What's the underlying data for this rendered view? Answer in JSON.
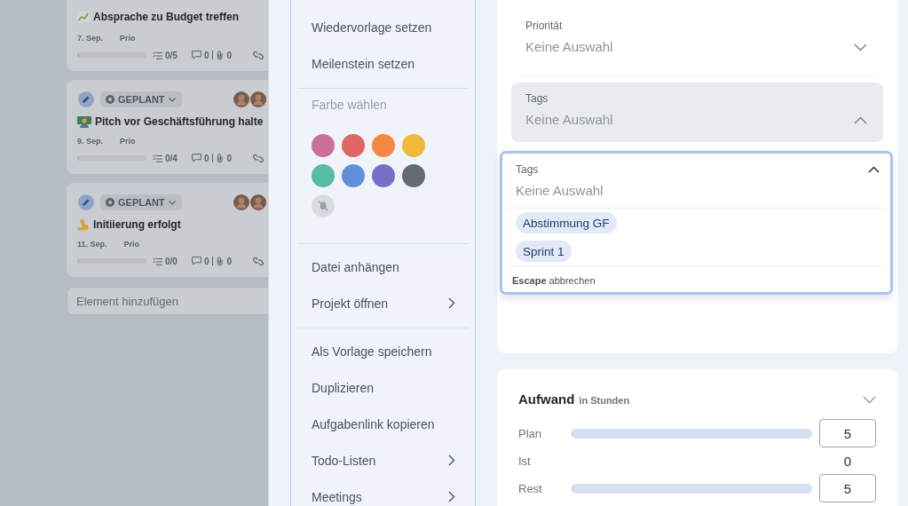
{
  "board": {
    "cards": [
      {
        "title": "Absprache zu Budget treffen",
        "date": "7. Sep.",
        "priority": "Prio",
        "level": 0,
        "checklist": "0/5",
        "comments": "0",
        "attachments": "0"
      },
      {
        "status": "GEPLANT",
        "assignees": [
          {
            "kind": "photo"
          },
          {
            "kind": "photo"
          }
        ],
        "title": "Pitch vor Geschäftsführung halte",
        "date": "9. Sep.",
        "priority": "Prio",
        "level": 0,
        "checklist": "0/4",
        "comments": "0",
        "attachments": "0"
      },
      {
        "status": "GEPLANT",
        "assignees": [
          {
            "kind": "photo"
          },
          {
            "kind": "photo"
          }
        ],
        "title": "Initiierung erfolgt",
        "date": "11. Sep.",
        "priority": "Prio",
        "level": 0,
        "checklist": "0/0",
        "comments": "0",
        "attachments": "0"
      }
    ],
    "add_item": {
      "placeholder": "Element hinzufügen"
    }
  },
  "menu": [
    {
      "kind": "item",
      "label": "Wiedervorlage setzen",
      "submenu": false
    },
    {
      "kind": "item",
      "label": "Meilenstein setzen",
      "submenu": false
    },
    {
      "kind": "divider"
    },
    {
      "kind": "heading",
      "label": "Farbe wählen"
    },
    {
      "kind": "colors",
      "swatches": [
        {
          "color": "#c96f9c",
          "selected": false
        },
        {
          "color": "#e06565",
          "selected": false
        },
        {
          "color": "#f38842",
          "selected": false
        },
        {
          "color": "#f0b93b",
          "selected": false
        },
        {
          "color": "#56bda4",
          "selected": false
        },
        {
          "color": "#5f90d9",
          "selected": false
        },
        {
          "color": "#7571c6",
          "selected": false
        },
        {
          "color": "#616b76",
          "selected": false
        }
      ],
      "none_option": {
        "selected": false
      }
    },
    {
      "kind": "divider"
    },
    {
      "kind": "item",
      "label": "Datei anhängen",
      "submenu": false
    },
    {
      "kind": "item",
      "label": "Projekt öffnen",
      "submenu": true
    },
    {
      "kind": "divider"
    },
    {
      "kind": "item",
      "label": "Als Vorlage speichern",
      "submenu": false
    },
    {
      "kind": "item",
      "label": "Duplizieren",
      "submenu": false
    },
    {
      "kind": "item",
      "label": "Aufgabenlink kopieren",
      "submenu": false
    },
    {
      "kind": "item",
      "label": "Todo-Listen",
      "submenu": true
    },
    {
      "kind": "item",
      "label": "Meetings",
      "submenu": true
    }
  ],
  "details": {
    "fields": [
      {
        "label": "Priorität",
        "placeholder": "Keine Auswahl",
        "expanded": false,
        "focused": false
      },
      {
        "label": "Tags",
        "placeholder": "Keine Auswahl",
        "expanded": true,
        "focused": true
      }
    ],
    "tags_dropdown": {
      "label": "Tags",
      "placeholder": "Keine Auswahl",
      "expanded": true,
      "options": [
        {
          "label": "Abstimmung GF",
          "selected": false
        },
        {
          "label": "Sprint 1",
          "selected": false
        }
      ],
      "hint": "**Escape** abbrechen"
    }
  },
  "effort": {
    "title": "Aufwand",
    "unit": "in Stunden",
    "expanded": false,
    "rows": [
      {
        "kind": "input",
        "label": "Plan",
        "level": 0,
        "value": "5"
      },
      {
        "kind": "text",
        "label": "Ist",
        "value": "0"
      },
      {
        "kind": "input",
        "label": "Rest",
        "level": 0,
        "value": "5"
      }
    ]
  }
}
